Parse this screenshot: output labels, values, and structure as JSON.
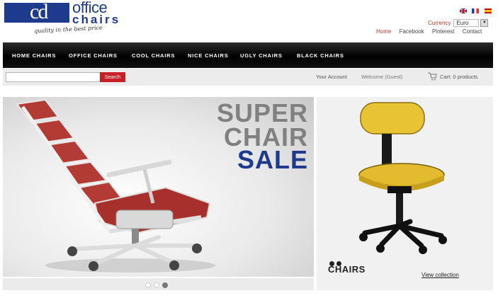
{
  "logo": {
    "mark": "cd",
    "word1": "office",
    "word2": "chairs",
    "tagline": "quality in the best price"
  },
  "header": {
    "flags": [
      {
        "name": "uk-flag-icon",
        "colors": [
          "#23408e",
          "#c8102e"
        ]
      },
      {
        "name": "fr-flag-icon",
        "colors": [
          "#23408e",
          "#ffffff",
          "#ed2939"
        ]
      },
      {
        "name": "es-flag-icon",
        "colors": [
          "#c60b1e",
          "#ffc400"
        ]
      }
    ],
    "currency_label": "Currency",
    "currency_value": "Euro",
    "links": [
      "Home",
      "Facebook",
      "Pinterest",
      "Contact"
    ]
  },
  "nav": {
    "items": [
      "HOME CHAIRS",
      "OFFICE CHAIRS",
      "COOL CHAIRS",
      "NICE CHAIRS",
      "UGLY CHAIRS",
      "BLACK CHAIRS"
    ]
  },
  "search": {
    "placeholder": "",
    "button": "Search"
  },
  "account": {
    "label": "Your Account",
    "welcome": "Welcome (Guest)",
    "cart": "Cart: 0 products"
  },
  "banner": {
    "line1": "SUPER",
    "line2": "CHAIR",
    "line3": "SALE"
  },
  "promo": {
    "label": "CHAIRS",
    "link": "View collection"
  },
  "colors": {
    "brand": "#1d3a8c",
    "accent": "#c62026"
  }
}
